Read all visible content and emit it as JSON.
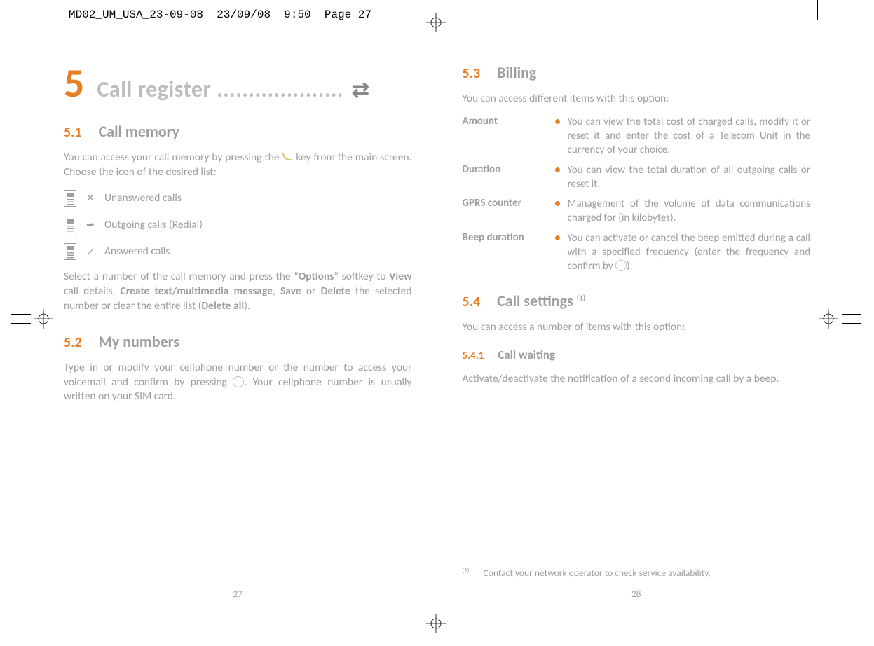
{
  "slug": "MD02_UM_USA_23-09-08  23/09/08  9:50  Page 27",
  "left": {
    "chapter_num": "5",
    "chapter_title": "Call register ....................",
    "s51": {
      "num": "5.1",
      "title": "Call memory"
    },
    "p51a": "You can access your call memory by pressing the ",
    "p51b": " key from the main screen. Choose the icon of the desired list:",
    "list": {
      "unanswered": "Unanswered calls",
      "outgoing": "Outgoing calls (Redial)",
      "answered": "Answered calls"
    },
    "p51c1": "Select a number of the call memory and press the “",
    "p51c_opt": "Options",
    "p51c2": "” softkey to ",
    "p51c_view": "View",
    "p51c3": " call details, ",
    "p51c_create": "Create text/multimedia message",
    "p51c4": ", ",
    "p51c_save": "Save",
    "p51c5": " or ",
    "p51c_delete": "Delete",
    "p51c6": " the selected number or clear the entire list (",
    "p51c_delall": "Delete all",
    "p51c7": ").",
    "s52": {
      "num": "5.2",
      "title": "My numbers"
    },
    "p52a": "Type in or modify your cellphone number or the number to access your voicemail and confirm by pressing ",
    "p52b": ". Your cellphone number is usually written on your SIM card.",
    "pagenum": "27"
  },
  "right": {
    "s53": {
      "num": "5.3",
      "title": "Billing"
    },
    "p53": "You can access different items with this option:",
    "dl": {
      "amount": {
        "term": "Amount",
        "def": "You can view the total cost of charged calls, modify it or reset it and enter the cost of a Telecom Unit in the currency of your choice."
      },
      "duration": {
        "term": "Duration",
        "def": "You can view the total duration of all outgoing calls or reset it."
      },
      "gprs": {
        "term": "GPRS counter",
        "def": "Management of the volume of data communications charged for (in kilobytes)."
      },
      "beep": {
        "term": "Beep duration",
        "def_a": "You can activate or cancel the beep emitted during a call with a specified frequency (enter the frequency and confirm by ",
        "def_b": ")."
      }
    },
    "s54": {
      "num": "5.4",
      "title": "Call settings ",
      "sup": "(1)"
    },
    "p54": "You can access a number of items with this option:",
    "s541": {
      "num": "5.4.1",
      "title": "Call waiting"
    },
    "p541": "Activate/deactivate the notification of a second incoming call by a beep.",
    "footnote": {
      "sup": "(1)",
      "text": "Contact your network operator to check service availability."
    },
    "pagenum": "28"
  }
}
